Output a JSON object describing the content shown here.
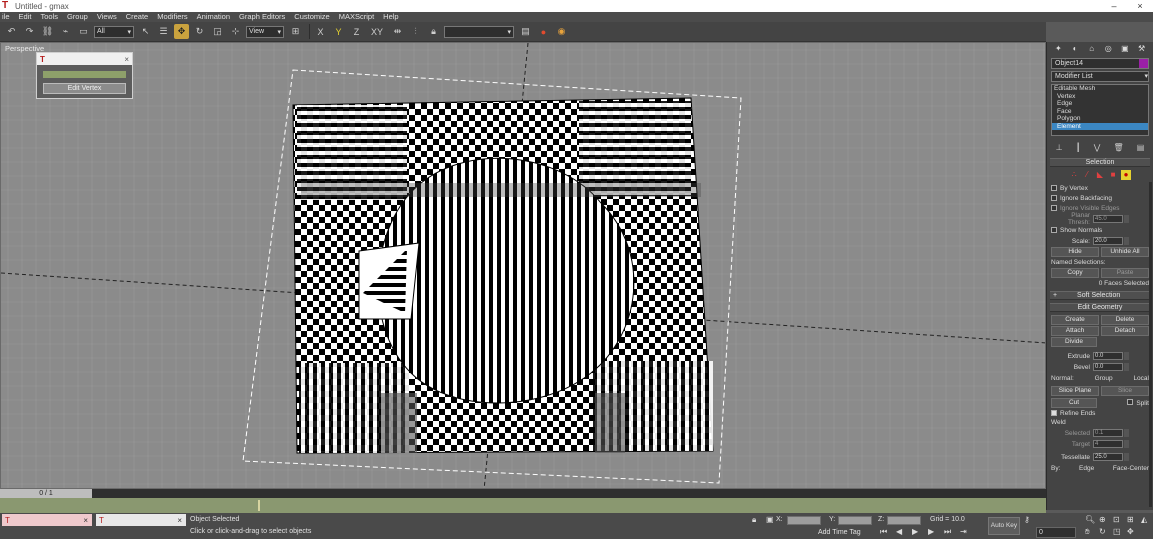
{
  "window": {
    "title": "Untitled - gmax",
    "minimize": "–",
    "close": "×"
  },
  "menu": [
    "ile",
    "Edit",
    "Tools",
    "Group",
    "Views",
    "Create",
    "Modifiers",
    "Animation",
    "Graph Editors",
    "Customize",
    "MAXScript",
    "Help"
  ],
  "toolbar": {
    "selection_filter": "All",
    "reference_coord": "View",
    "named_selection": "",
    "axis_labels": [
      "X",
      "Y",
      "Z",
      "XY"
    ]
  },
  "viewport": {
    "label": "Perspective"
  },
  "float_dialog": {
    "button_label": "Edit Vertex",
    "close": "×"
  },
  "command_panel": {
    "object_name": "Object14",
    "object_color": "#9b1fa7",
    "modifier_list": "Modifier List",
    "stack": [
      {
        "label": "Editable Mesh",
        "selected": false
      },
      {
        "label": "Vertex",
        "selected": false
      },
      {
        "label": "Edge",
        "selected": false
      },
      {
        "label": "Face",
        "selected": false
      },
      {
        "label": "Polygon",
        "selected": false
      },
      {
        "label": "Element",
        "selected": true
      }
    ],
    "selection_rollout": {
      "title": "Selection",
      "by_vertex": "By Vertex",
      "ignore_backfacing": "Ignore Backfacing",
      "ignore_visible_edges": "Ignore Visible Edges",
      "planar_thresh_label": "Planar Thresh:",
      "planar_thresh_value": "45.0",
      "show_normals": "Show Normals",
      "scale_label": "Scale:",
      "scale_value": "20.0",
      "hide": "Hide",
      "unhide_all": "Unhide All",
      "named_selections": "Named Selections:",
      "copy": "Copy",
      "paste": "Paste",
      "selection_count": "0 Faces Selected"
    },
    "soft_selection": {
      "title": "Soft Selection",
      "toggle": "+"
    },
    "edit_geometry": {
      "title": "Edit Geometry",
      "create": "Create",
      "delete": "Delete",
      "attach": "Attach",
      "detach": "Detach",
      "divide": "Divide",
      "extrude_label": "Extrude",
      "extrude_value": "0.0",
      "bevel_label": "Bevel",
      "bevel_value": "0.0",
      "normal_label": "Normal:",
      "group": "Group",
      "local": "Local",
      "slice_plane": "Slice Plane",
      "slice": "Slice",
      "cut": "Cut",
      "split": "Split",
      "refine_ends": "Refine Ends",
      "weld_header": "Weld",
      "selected_label": "Selected",
      "selected_value": "0.1",
      "target_label": "Target",
      "target_value": "4",
      "tessellate_label": "Tessellate",
      "tessellate_value": "25.0",
      "by_label": "By:",
      "edge": "Edge",
      "face_center": "Face-Center"
    }
  },
  "timeline": {
    "frame": "0 / 1"
  },
  "status": {
    "task1": "",
    "task2": "",
    "task_close": "×",
    "message": "Object Selected",
    "prompt": "Click or click-and-drag to select objects",
    "x_label": "X:",
    "y_label": "Y:",
    "z_label": "Z:",
    "grid": "Grid = 10.0",
    "add_time_tag": "Add Time Tag",
    "auto_key": "Auto Key",
    "frame_field": "0"
  }
}
